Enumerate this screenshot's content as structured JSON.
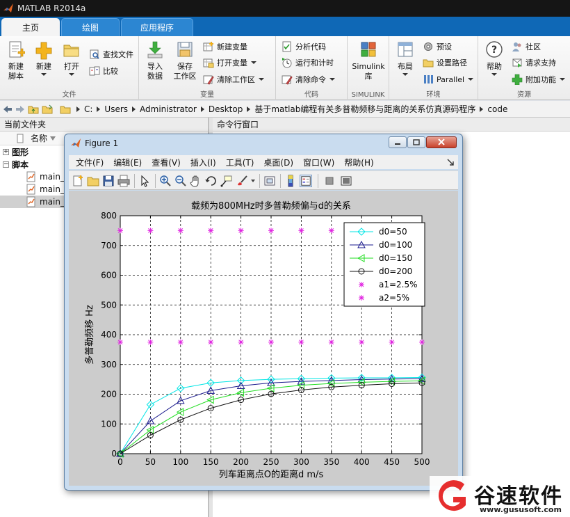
{
  "window": {
    "title": "MATLAB R2014a"
  },
  "tabs": [
    {
      "label": "主页",
      "active": true
    },
    {
      "label": "绘图",
      "active": false
    },
    {
      "label": "应用程序",
      "active": false
    }
  ],
  "ribbon": {
    "file": {
      "label": "文件",
      "new_script": "新建\n脚本",
      "new": "新建",
      "open": "打开",
      "find_files": "查找文件",
      "compare": "比较"
    },
    "variable": {
      "label": "变量",
      "import_data": "导入\n数据",
      "save_workspace": "保存\n工作区",
      "new_variable": "新建变量",
      "open_variable": "打开变量",
      "clear_workspace": "清除工作区"
    },
    "code": {
      "label": "代码",
      "analyze_code": "分析代码",
      "run_and_time": "运行和计时",
      "clear_commands": "清除命令"
    },
    "simulink": {
      "label": "SIMULINK",
      "library": "Simulink\n库"
    },
    "environment": {
      "label": "环境",
      "layout": "布局",
      "preferences": "预设",
      "set_path": "设置路径",
      "parallel": "Parallel"
    },
    "resources": {
      "label": "资源",
      "help": "帮助",
      "community": "社区",
      "request_support": "请求支持",
      "addons": "附加功能"
    }
  },
  "address": {
    "crumbs": [
      "C:",
      "Users",
      "Administrator",
      "Desktop",
      "基于matlab编程有关多普勒频移与距离的关系仿真源码程序",
      "code"
    ]
  },
  "current_folder": {
    "title": "当前文件夹",
    "column_name": "名称",
    "groups": [
      {
        "label": "图形",
        "expander": "+"
      },
      {
        "label": "脚本",
        "expander": "−"
      }
    ],
    "files": [
      "main_",
      "main_",
      "main_"
    ]
  },
  "command_window": {
    "title": "命令行窗口"
  },
  "figure": {
    "title": "Figure 1",
    "menu": [
      "文件(F)",
      "编辑(E)",
      "查看(V)",
      "插入(I)",
      "工具(T)",
      "桌面(D)",
      "窗口(W)",
      "帮助(H)"
    ]
  },
  "chart_data": {
    "type": "line",
    "title": "载频为800MHz时多普勒频偏与d的关系",
    "xlabel": "列车距离点O的距离d m/s",
    "ylabel": "多普勒频移 Hz",
    "xlim": [
      0,
      500
    ],
    "ylim": [
      0,
      800
    ],
    "xticks": [
      0,
      50,
      100,
      150,
      200,
      250,
      300,
      350,
      400,
      450,
      500
    ],
    "yticks": [
      0,
      100,
      200,
      300,
      400,
      500,
      600,
      700,
      800
    ],
    "grid": true,
    "legend_position": "top-right",
    "x": [
      0,
      50,
      100,
      150,
      200,
      250,
      300,
      350,
      400,
      450,
      500
    ],
    "series": [
      {
        "name": "d0=50",
        "color": "#00e5e5",
        "marker": "diamond",
        "values": [
          0,
          165,
          220,
          238,
          246,
          250,
          252,
          254,
          255,
          255,
          256
        ]
      },
      {
        "name": "d0=100",
        "color": "#1a1a8c",
        "marker": "triangle-up",
        "values": [
          0,
          110,
          178,
          212,
          228,
          238,
          243,
          246,
          249,
          251,
          252
        ]
      },
      {
        "name": "d0=150",
        "color": "#22dd22",
        "marker": "triangle-left",
        "values": [
          0,
          80,
          140,
          181,
          205,
          220,
          230,
          236,
          240,
          243,
          245
        ]
      },
      {
        "name": "d0=200",
        "color": "#111111",
        "marker": "circle",
        "values": [
          0,
          62,
          114,
          153,
          181,
          201,
          214,
          224,
          230,
          235,
          238
        ]
      },
      {
        "name": "a1=2.5%",
        "color": "#e020e0",
        "marker": "star",
        "values": [
          375,
          375,
          375,
          375,
          375,
          375,
          375,
          375,
          375,
          375,
          375
        ]
      },
      {
        "name": "a2=5%",
        "color": "#e020e0",
        "marker": "star",
        "values": [
          750,
          750,
          750,
          750,
          750,
          750,
          750,
          750,
          750,
          750,
          750
        ]
      }
    ]
  },
  "watermark": {
    "brand": "谷速软件",
    "url": "www.gususoft.com"
  }
}
